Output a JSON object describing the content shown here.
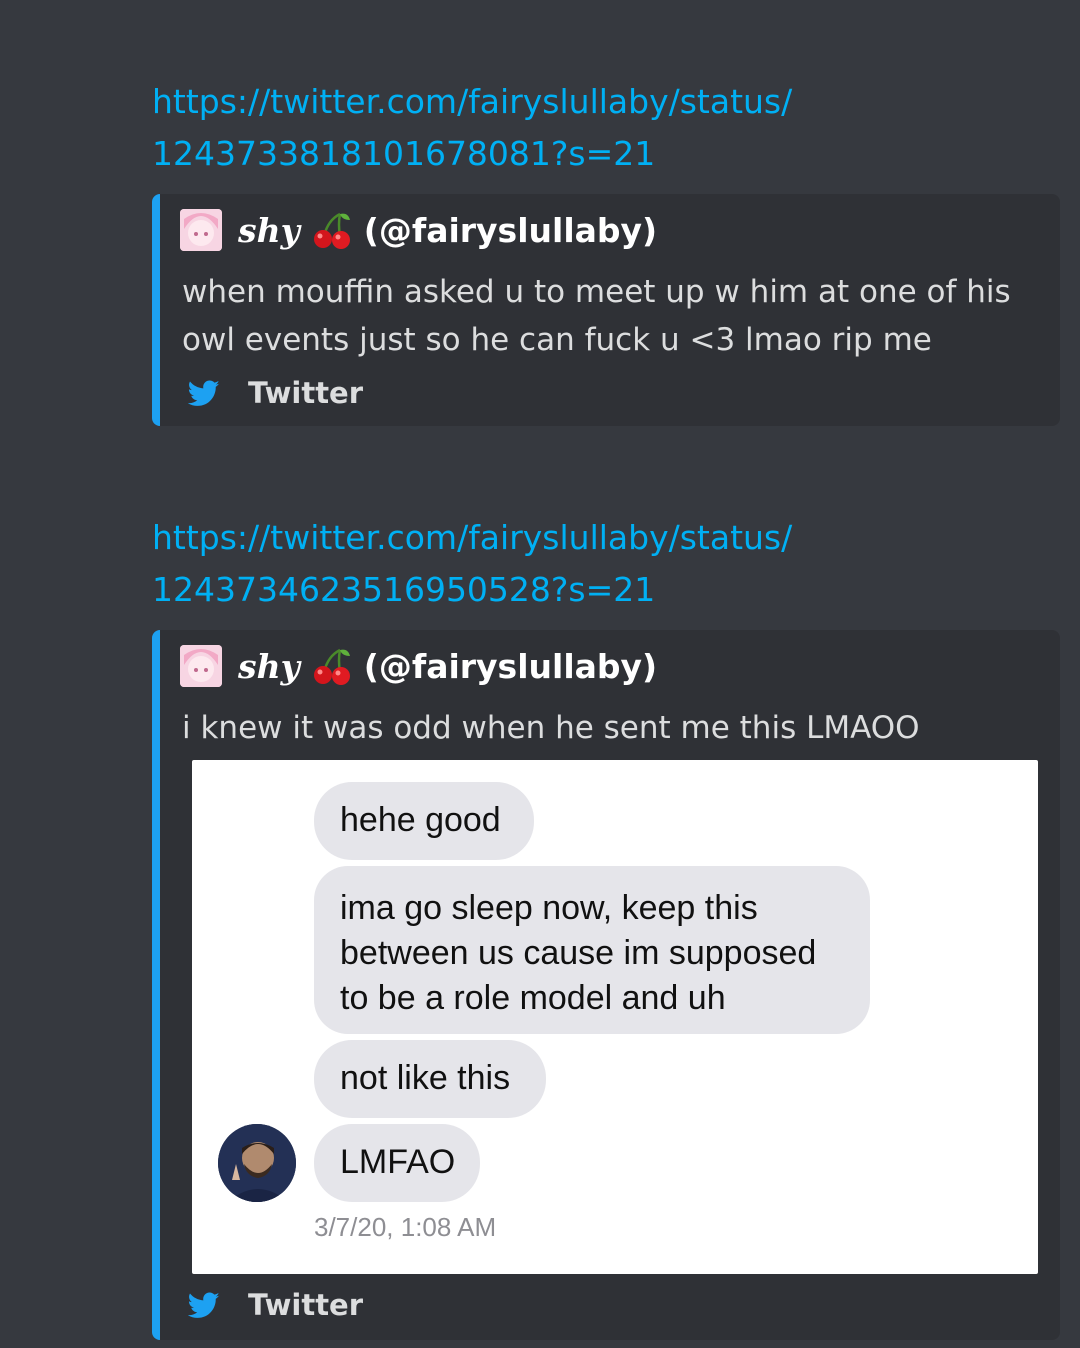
{
  "messages": [
    {
      "link": "https://twitter.com/fairyslullaby/status/1243733818101678081?s=21",
      "embed": {
        "author_name": "shy",
        "author_emoji": "cherry-icon",
        "author_handle": "(@fairyslullaby)",
        "description": "when mouffin asked u to meet up w him at one of his owl events just so he can fuck u <3 lmao rip me",
        "footer": "Twitter"
      }
    },
    {
      "link": "https://twitter.com/fairyslullaby/status/1243734623516950528?s=21",
      "embed": {
        "author_name": "shy",
        "author_emoji": "cherry-icon",
        "author_handle": "(@fairyslullaby)",
        "description": "i knew it was odd when he sent me this LMAOO",
        "footer": "Twitter",
        "image": {
          "bubbles": [
            "hehe good",
            "ima go sleep now, keep this between us cause im supposed to be a role model and uh",
            "not like this",
            "LMFAO"
          ],
          "timestamp": "3/7/20, 1:08 AM"
        }
      }
    }
  ],
  "colors": {
    "background": "#36393f",
    "embed_bg": "#2f3136",
    "accent": "#1da1f2",
    "link": "#00b0f4",
    "bubble": "#e5e5ea"
  }
}
